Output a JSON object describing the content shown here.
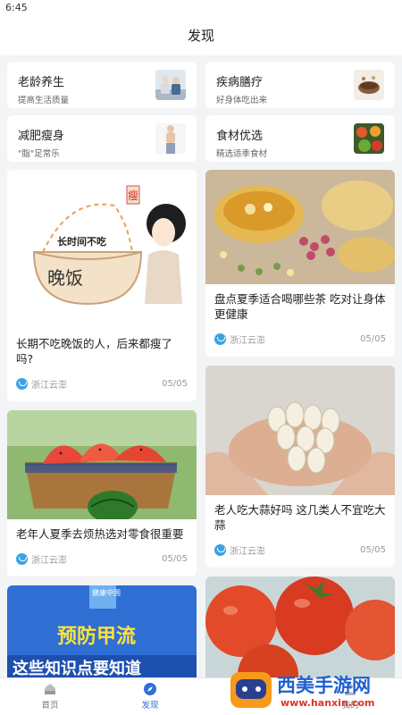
{
  "status": {
    "time": "6:45"
  },
  "header": {
    "title": "发现"
  },
  "categories": [
    {
      "title": "老龄养生",
      "sub": "提高生活质量"
    },
    {
      "title": "疾病膳疗",
      "sub": "好身体吃出来"
    },
    {
      "title": "减肥瘦身",
      "sub": "\"脂\"足常乐"
    },
    {
      "title": "食材优选",
      "sub": "精选适季食材"
    }
  ],
  "articles": {
    "left": [
      {
        "title": "长期不吃晚饭的人，后来都瘦了吗?",
        "source": "浙江云澎",
        "date": "05/05",
        "img_text_1": "长时间不吃",
        "img_text_2": "晚饭",
        "img_text_3": "瘦"
      },
      {
        "title": "老年人夏季去烦热选对零食很重要",
        "source": "浙江云澎",
        "date": "05/05"
      },
      {
        "title": "",
        "img_text_1": "预防甲流",
        "img_text_2": "这些知识点要知道",
        "img_text_3": "健康中国"
      }
    ],
    "right": [
      {
        "title": "盘点夏季适合喝哪些茶 吃对让身体更健康",
        "source": "浙江云澎",
        "date": "05/05"
      },
      {
        "title": "老人吃大蒜好吗 这几类人不宜吃大蒜",
        "source": "浙江云澎",
        "date": "05/05"
      },
      {
        "title": ""
      }
    ]
  },
  "tabbar": {
    "home": "首页",
    "discover": "发现",
    "mine": "我的"
  },
  "watermark": {
    "brand": "西美手游网",
    "url": "www.hanxin.com"
  },
  "colors": {
    "accent": "#2e6fd8",
    "source_icon": "#3aa3e3"
  }
}
